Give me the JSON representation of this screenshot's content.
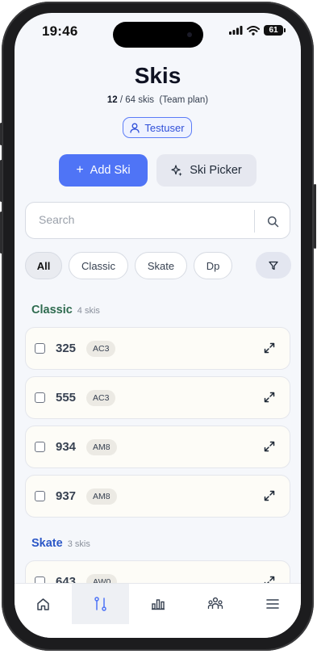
{
  "status": {
    "time": "19:46",
    "battery": "61"
  },
  "page": {
    "title": "Skis",
    "count_current": "12",
    "count_rest": "/ 64 skis",
    "plan": "(Team plan)"
  },
  "user": {
    "name": "Testuser"
  },
  "actions": {
    "add_label": "Add Ski",
    "picker_label": "Ski Picker"
  },
  "search": {
    "placeholder": "Search"
  },
  "filters": [
    "All",
    "Classic",
    "Skate",
    "Dp"
  ],
  "sections": [
    {
      "name": "Classic",
      "count": "4 skis",
      "color": "#2e6b4f",
      "items": [
        {
          "number": "325",
          "tag": "AC3"
        },
        {
          "number": "555",
          "tag": "AC3"
        },
        {
          "number": "934",
          "tag": "AM8"
        },
        {
          "number": "937",
          "tag": "AM8"
        }
      ]
    },
    {
      "name": "Skate",
      "count": "3 skis",
      "color": "#2b57c7",
      "items": [
        {
          "number": "643",
          "tag": "AW0"
        }
      ]
    }
  ],
  "nav": [
    "home-icon",
    "skis-icon",
    "stats-icon",
    "team-icon",
    "menu-icon"
  ],
  "colors": {
    "accent": "#4f74f6",
    "background": "#f5f7fb"
  }
}
